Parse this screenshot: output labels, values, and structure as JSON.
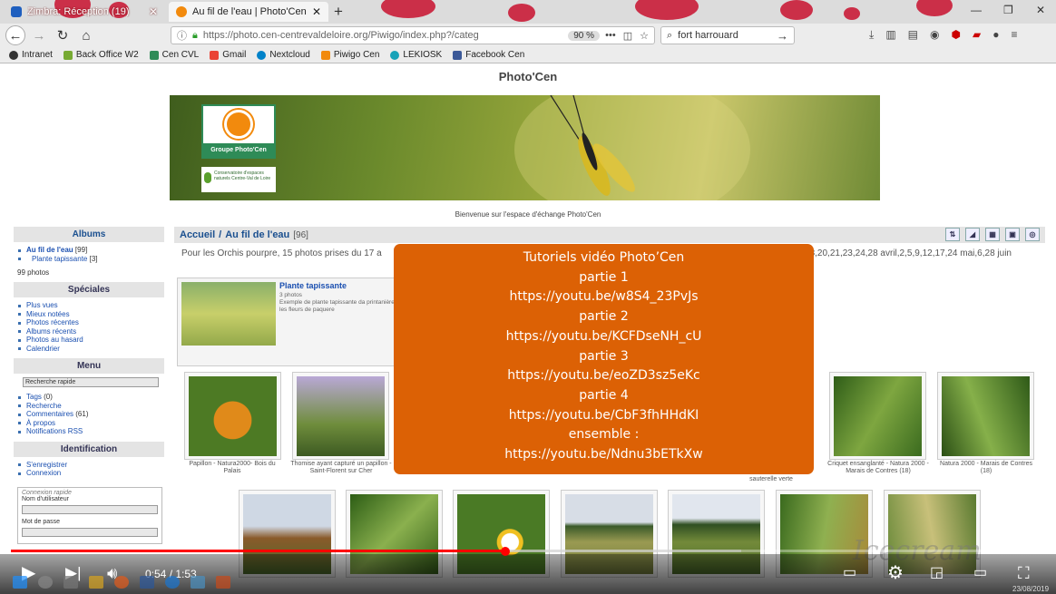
{
  "browser": {
    "tabs": [
      {
        "label": "Zimbra: Réception (19)",
        "active": false
      },
      {
        "label": "Au fil de l'eau | Photo'Cen",
        "active": true
      }
    ],
    "url": "https://photo.cen-centrevaldeloire.org/Piwigo/index.php?/categ",
    "zoom": "90 %",
    "search_value": "fort harrouard",
    "bookmarks": [
      "Intranet",
      "Back Office W2",
      "Cen CVL",
      "Gmail",
      "Nextcloud",
      "Piwigo Cen",
      "LEKIOSK",
      "Facebook Cen"
    ]
  },
  "site": {
    "title": "Photo'Cen",
    "logo_label": "Groupe Photo'Cen",
    "logo2_text": "Conservatoire d'espaces naturels Centre-Val de Loire",
    "welcome": "Bienvenue sur l'espace d'échange Photo'Cen"
  },
  "sidebar": {
    "albums_title": "Albums",
    "albums": [
      {
        "label": "Au fil de l'eau",
        "count": "[99]"
      },
      {
        "label": "Plante tapissante",
        "count": "[3]"
      }
    ],
    "photo_count": "99 photos",
    "specials_title": "Spéciales",
    "specials": [
      "Plus vues",
      "Mieux notées",
      "Photos récentes",
      "Albums récents",
      "Photos au hasard",
      "Calendrier"
    ],
    "menu_title": "Menu",
    "quick_search": "Recherche rapide",
    "menu_items": [
      {
        "label": "Tags",
        "count": "(0)"
      },
      {
        "label": "Recherche",
        "count": ""
      },
      {
        "label": "Commentaires",
        "count": "(61)"
      },
      {
        "label": "À propos",
        "count": ""
      },
      {
        "label": "Notifications RSS",
        "count": ""
      }
    ],
    "ident_title": "Identification",
    "ident_items": [
      "S'enregistrer",
      "Connexion"
    ],
    "quick_login": "Connexion rapide",
    "username_label": "Nom d'utilisateur",
    "password_label": "Mot de passe"
  },
  "content": {
    "breadcrumb_home": "Accueil",
    "breadcrumb_sep": " / ",
    "breadcrumb_current": "Au fil de l'eau",
    "count": "[96]",
    "description_left": "Pour les Orchis pourpre, 15 photos prises du 17 a",
    "description_right": "7,18,20,21,23,24,28 avril,2,5,9,12,17,24 mai,6,28 juin",
    "album_title": "Plante tapissante",
    "album_meta": "3 photos",
    "album_desc": "Exemple de plante tapissante da printanière, les fleurs de paquere",
    "captions": {
      "c1": "Papillon - Natura2000- Bois du Palais",
      "c2": "Thomise ayant capturé un papillon - Saint-Florent sur Cher",
      "c3": "Criquet ensanglanté - Natura 2000 - Marais de Contres (18)",
      "c4": "Natura 2000 - Marais de Contres (18)",
      "c5": "sauterelle verte"
    }
  },
  "overlay": {
    "lines": [
      "Tutoriels vidéo Photo’Cen",
      "partie 1",
      "https://youtu.be/w8S4_23PvJs",
      "partie 2",
      "https://youtu.be/KCFDseNH_cU",
      "partie 3",
      "https://youtu.be/eoZD3sz5eKc",
      "partie 4",
      "https://youtu.be/CbF3fhHHdKI",
      "ensemble :",
      "https://youtu.be/Ndnu3bETkXw"
    ]
  },
  "player": {
    "time": "0:54 / 1:53",
    "progress_fraction": 0.478,
    "watermark": "Icecream",
    "date": "23/08/2019"
  },
  "colors": {
    "accent_overlay": "#dc6105",
    "progress": "#ff0000",
    "link": "#1a4fb0"
  }
}
